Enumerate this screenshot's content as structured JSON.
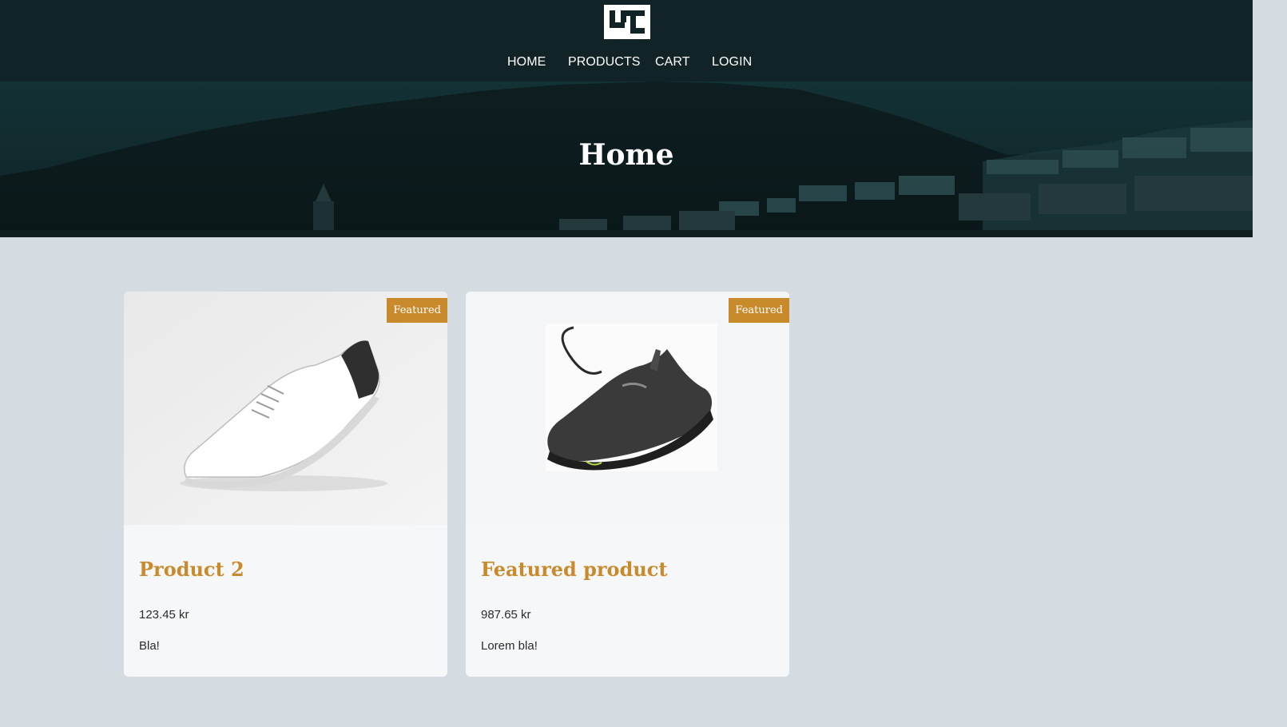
{
  "nav": {
    "items": [
      {
        "label": "HOME"
      },
      {
        "label": "PRODUCTS"
      },
      {
        "label": "CART"
      },
      {
        "label": "LOGIN"
      }
    ]
  },
  "hero": {
    "title": "Home"
  },
  "products": [
    {
      "badge": "Featured",
      "title": "Product 2",
      "price": "123.45 kr",
      "description": "Bla!",
      "image_icon": "white-sneaker-image"
    },
    {
      "badge": "Featured",
      "title": "Featured product",
      "price": "987.65 kr",
      "description": "Lorem bla!",
      "image_icon": "black-running-shoe-image"
    }
  ],
  "colors": {
    "header_bg": "#112326",
    "page_bg": "#d4dce1",
    "accent": "#c98a2c",
    "card_bg": "#f6f7f9"
  }
}
